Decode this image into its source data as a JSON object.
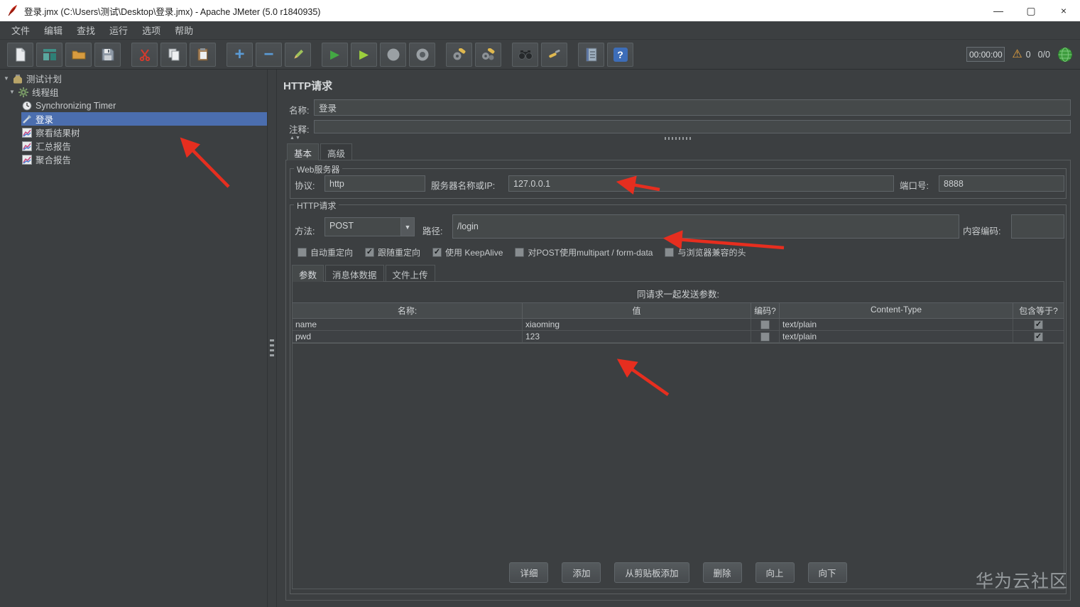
{
  "window": {
    "title": "登录.jmx (C:\\Users\\测试\\Desktop\\登录.jmx) - Apache JMeter (5.0 r1840935)",
    "minimize_glyph": "—",
    "maximize_glyph": "▢",
    "close_glyph": "×"
  },
  "menubar": {
    "items": [
      {
        "label": "文件"
      },
      {
        "label": "编辑"
      },
      {
        "label": "查找"
      },
      {
        "label": "运行"
      },
      {
        "label": "选项"
      },
      {
        "label": "帮助"
      }
    ]
  },
  "toolbar": {
    "timer": "00:00:00",
    "warning_count": "0",
    "thread_count": "0/0"
  },
  "icons": {
    "plus": "+",
    "minus": "−",
    "play": "▶",
    "play_no_pause": "▶",
    "help_mark": "?",
    "warning": "⚠",
    "twisty_expanded": "▼",
    "combo_arrow": "▼",
    "check": "✓",
    "splitter_up": "▲",
    "splitter_down": "▼"
  },
  "tree": {
    "items": [
      {
        "label": "测试计划"
      },
      {
        "label": "线程组"
      },
      {
        "label": "Synchronizing Timer"
      },
      {
        "label": "登录",
        "selected": true
      },
      {
        "label": "察看结果树"
      },
      {
        "label": "汇总报告"
      },
      {
        "label": "聚合报告"
      }
    ]
  },
  "main": {
    "title": "HTTP请求",
    "name_label": "名称:",
    "name_value": "登录",
    "comment_label": "注释:",
    "comment_value": "",
    "tabs": {
      "basic": "基本",
      "advanced": "高级"
    },
    "web_server": {
      "group_title": "Web服务器",
      "protocol_label": "协议:",
      "protocol_value": "http",
      "server_label": "服务器名称或IP:",
      "server_value": "127.0.0.1",
      "port_label": "端口号:",
      "port_value": "8888"
    },
    "http_request": {
      "group_title": "HTTP请求",
      "method_label": "方法:",
      "method_value": "POST",
      "path_label": "路径:",
      "path_value": "/login",
      "encoding_label": "内容编码:",
      "encoding_value": "",
      "options": [
        {
          "label": "自动重定向",
          "checked": false
        },
        {
          "label": "跟随重定向",
          "checked": true
        },
        {
          "label": "使用 KeepAlive",
          "checked": true
        },
        {
          "label": "对POST使用multipart / form-data",
          "checked": false
        },
        {
          "label": "与浏览器兼容的头",
          "checked": false
        }
      ],
      "body_tabs": {
        "params": "参数",
        "body_data": "消息体数据",
        "files_upload": "文件上传"
      },
      "params": {
        "caption": "同请求一起发送参数:",
        "columns": [
          "名称:",
          "值",
          "编码?",
          "Content-Type",
          "包含等于?"
        ],
        "rows": [
          {
            "name": "name",
            "value": "xiaoming",
            "encode": false,
            "content_type": "text/plain",
            "include_equals": true
          },
          {
            "name": "pwd",
            "value": "123",
            "encode": false,
            "content_type": "text/plain",
            "include_equals": true
          }
        ],
        "buttons": {
          "detail": "详细",
          "add": "添加",
          "add_from_clipboard": "从剪贴板添加",
          "delete": "删除",
          "up": "向上",
          "down": "向下"
        }
      }
    }
  },
  "watermark": "华为云社区"
}
